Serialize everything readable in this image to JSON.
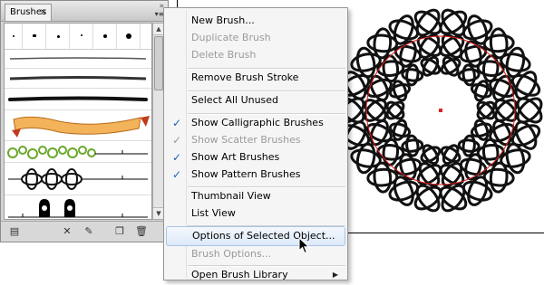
{
  "panel": {
    "tab_label": "Brushes",
    "tab_close": "×",
    "close_glyph": "»",
    "menu_glyph": "▾≡",
    "footer_icons": [
      "brush-libraries-icon",
      "remove-stroke-icon",
      "brush-options-icon",
      "new-brush-icon",
      "delete-brush-icon"
    ]
  },
  "menu": {
    "items": [
      {
        "label": "New Brush...",
        "enabled": true
      },
      {
        "label": "Duplicate Brush",
        "enabled": false
      },
      {
        "label": "Delete Brush",
        "enabled": false
      },
      {
        "label": "Remove Brush Stroke",
        "enabled": true
      },
      {
        "label": "Select All Unused",
        "enabled": true
      },
      {
        "label": "Show Calligraphic Brushes",
        "enabled": true,
        "checked": true
      },
      {
        "label": "Show Scatter Brushes",
        "enabled": false,
        "checked": true
      },
      {
        "label": "Show Art Brushes",
        "enabled": true,
        "checked": true
      },
      {
        "label": "Show Pattern Brushes",
        "enabled": true,
        "checked": true
      },
      {
        "label": "Thumbnail View",
        "enabled": true
      },
      {
        "label": "List View",
        "enabled": true
      },
      {
        "label": "Options of Selected Object...",
        "enabled": true,
        "highlighted": true
      },
      {
        "label": "Brush Options...",
        "enabled": false
      },
      {
        "label": "Open Brush Library",
        "enabled": true,
        "submenu": true
      }
    ],
    "check_glyph": "✓",
    "submenu_glyph": "▶"
  },
  "colors": {
    "highlight": "#dce9f9",
    "check": "#1b5fb3",
    "ribbon": "#f0a040",
    "leaf_green": "#6aa82a",
    "path_red": "#e02020"
  }
}
